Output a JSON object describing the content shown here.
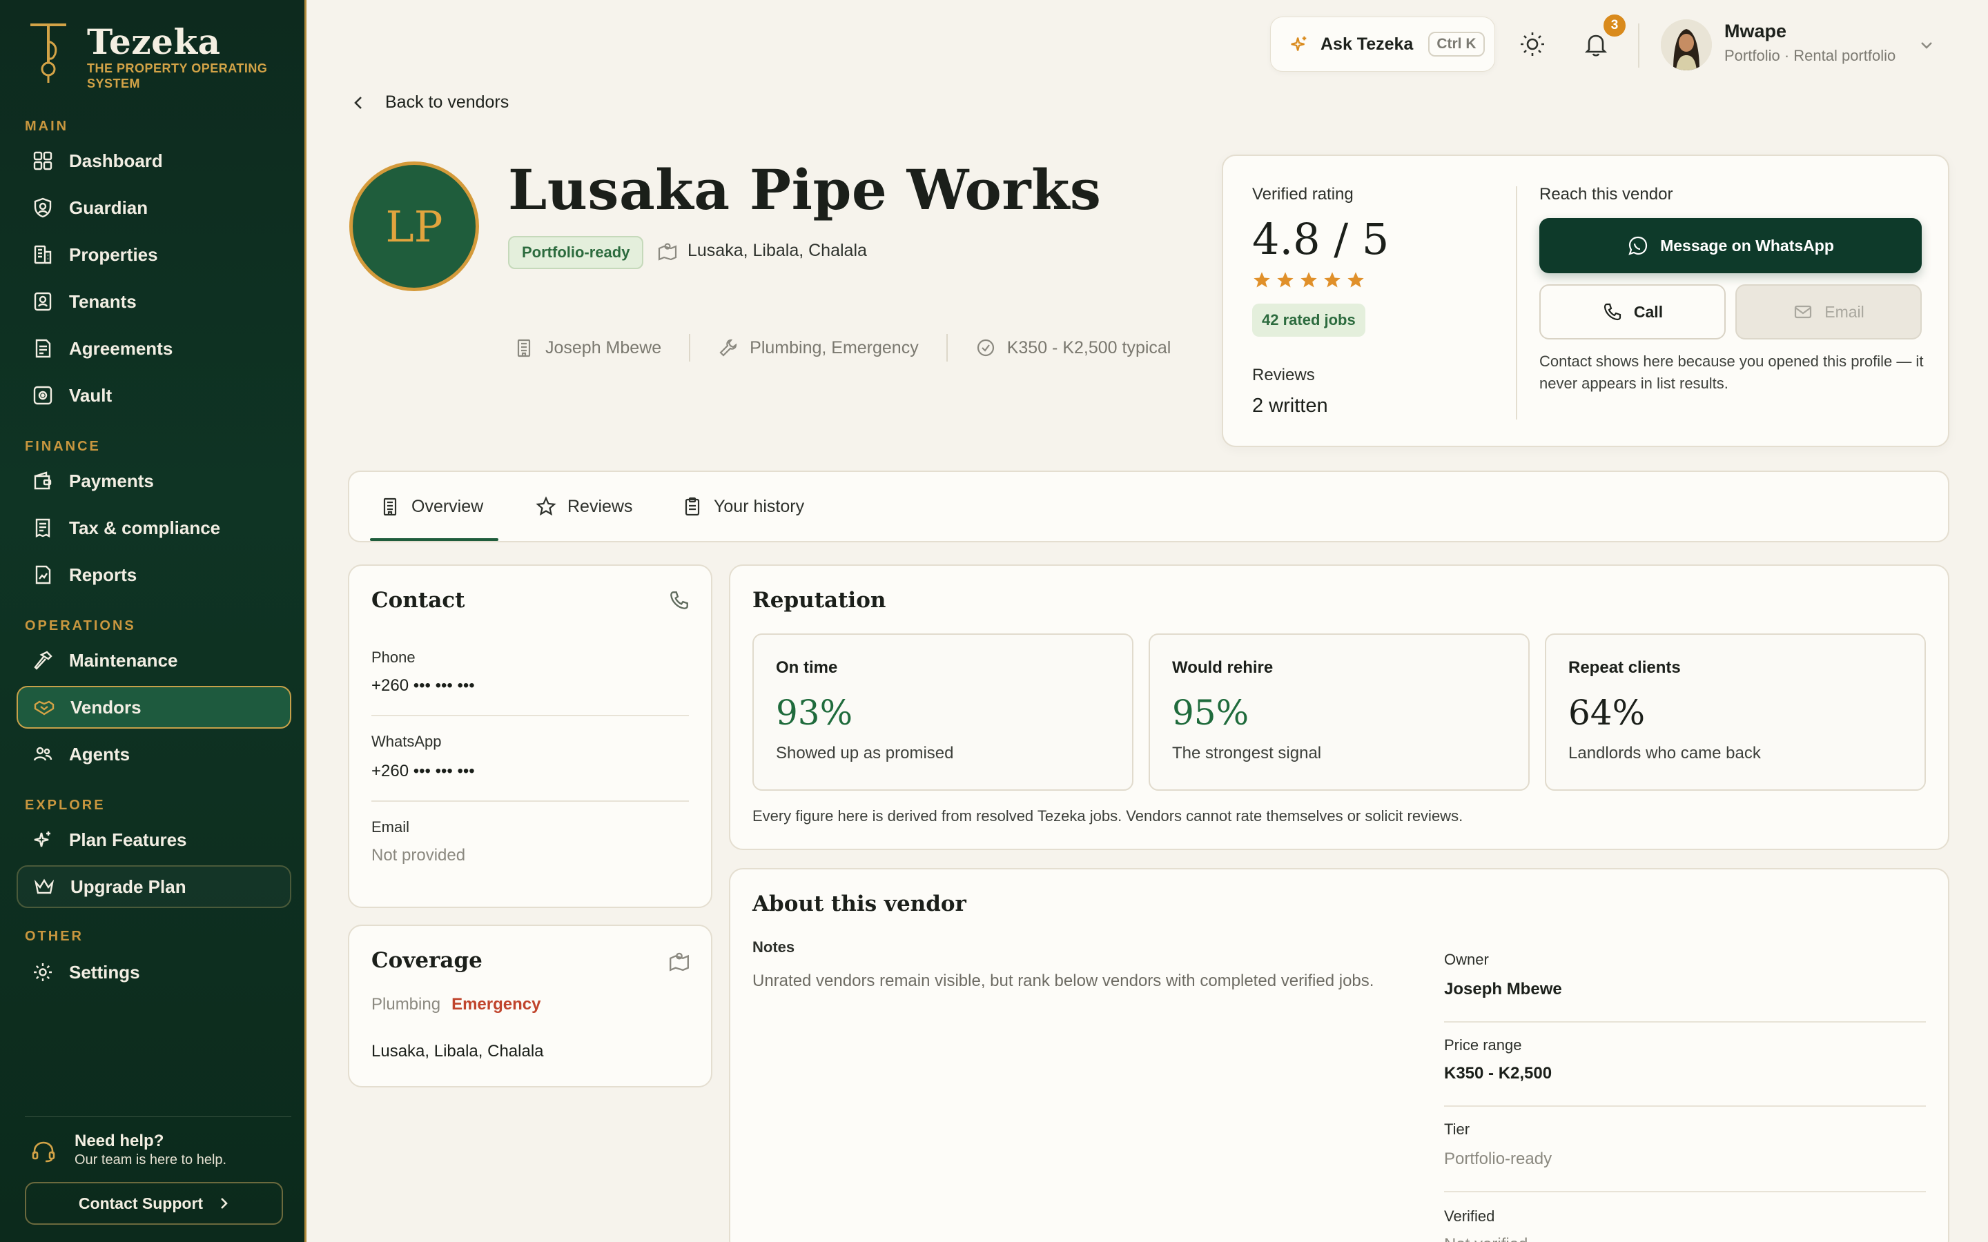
{
  "brand": {
    "name": "Tezeka",
    "tagline": "The property operating system"
  },
  "sidebar": {
    "sections": [
      {
        "label": "MAIN",
        "items": [
          {
            "label": "Dashboard",
            "icon": "grid-icon"
          },
          {
            "label": "Guardian",
            "icon": "guardian-icon"
          },
          {
            "label": "Properties",
            "icon": "building-icon"
          },
          {
            "label": "Tenants",
            "icon": "tenant-icon"
          },
          {
            "label": "Agreements",
            "icon": "document-icon"
          },
          {
            "label": "Vault",
            "icon": "vault-icon"
          }
        ]
      },
      {
        "label": "FINANCE",
        "items": [
          {
            "label": "Payments",
            "icon": "wallet-icon"
          },
          {
            "label": "Tax & compliance",
            "icon": "receipt-icon"
          },
          {
            "label": "Reports",
            "icon": "report-icon"
          }
        ]
      },
      {
        "label": "OPERATIONS",
        "items": [
          {
            "label": "Maintenance",
            "icon": "hammer-icon"
          },
          {
            "label": "Vendors",
            "icon": "handshake-icon",
            "active": true
          },
          {
            "label": "Agents",
            "icon": "users-icon"
          }
        ]
      },
      {
        "label": "EXPLORE",
        "items": [
          {
            "label": "Plan Features",
            "icon": "sparkle-icon"
          },
          {
            "label": "Upgrade Plan",
            "icon": "crown-icon"
          }
        ]
      },
      {
        "label": "OTHER",
        "items": [
          {
            "label": "Settings",
            "icon": "gear-icon"
          }
        ]
      }
    ],
    "help": {
      "title": "Need help?",
      "subtitle": "Our team is here to help.",
      "button": "Contact Support"
    }
  },
  "topbar": {
    "ask_label": "Ask Tezeka",
    "ask_shortcut": "Ctrl K",
    "notification_count": "3",
    "user_name": "Mwape",
    "user_subtitle": "Portfolio · Rental portfolio"
  },
  "back_label": "Back to vendors",
  "vendor": {
    "initials": "LP",
    "name": "Lusaka Pipe Works",
    "tier_badge": "Portfolio-ready",
    "location": "Lusaka, Libala, Chalala",
    "owner": "Joseph Mbewe",
    "services": "Plumbing, Emergency",
    "price_typical": "K350 - K2,500 typical"
  },
  "rating_card": {
    "label": "Verified rating",
    "score": "4.8 / 5",
    "stars": 5,
    "jobs": "42 rated jobs",
    "reviews_label": "Reviews",
    "reviews_value": "2 written",
    "reach_label": "Reach this vendor",
    "whatsapp_label": "Message on WhatsApp",
    "call_label": "Call",
    "email_label": "Email",
    "note": "Contact shows here because you opened this profile — it never appears in list results.",
    "accent": "#0e3a2a",
    "star_color": "#e0902a"
  },
  "tabs": [
    {
      "label": "Overview",
      "icon": "building-icon",
      "active": true
    },
    {
      "label": "Reviews",
      "icon": "star-icon"
    },
    {
      "label": "Your history",
      "icon": "clipboard-icon"
    }
  ],
  "contact": {
    "title": "Contact",
    "phone_label": "Phone",
    "phone_value": "+260 ••• ••• •••",
    "whatsapp_label": "WhatsApp",
    "whatsapp_value": "+260 ••• ••• •••",
    "email_label": "Email",
    "email_value": "Not provided"
  },
  "coverage": {
    "title": "Coverage",
    "service_1": "Plumbing",
    "service_2": "Emergency",
    "areas": "Lusaka, Libala, Chalala"
  },
  "reputation": {
    "title": "Reputation",
    "stats": [
      {
        "title": "On time",
        "value": "93%",
        "sub": "Showed up as promised",
        "color": "#1f6b3c"
      },
      {
        "title": "Would rehire",
        "value": "95%",
        "sub": "The strongest signal",
        "color": "#1f6b3c"
      },
      {
        "title": "Repeat clients",
        "value": "64%",
        "sub": "Landlords who came back",
        "color": "#1b1f1a"
      }
    ],
    "note": "Every figure here is derived from resolved Tezeka jobs. Vendors cannot rate themselves or solicit reviews."
  },
  "about": {
    "title": "About this vendor",
    "notes_label": "Notes",
    "notes_text": "Unrated vendors remain visible, but rank below vendors with completed verified jobs.",
    "owner_label": "Owner",
    "owner_value": "Joseph Mbewe",
    "price_label": "Price range",
    "price_value": "K350 - K2,500",
    "tier_label": "Tier",
    "tier_value": "Portfolio-ready",
    "verified_label": "Verified",
    "verified_value": "Not verified"
  }
}
